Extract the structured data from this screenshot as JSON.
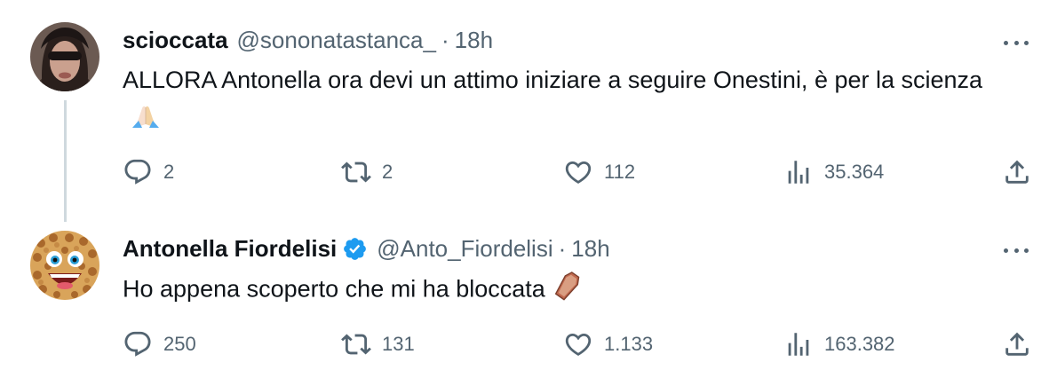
{
  "tweets": [
    {
      "name": "scioccata",
      "handle": "@sononatastanca_",
      "separator": "·",
      "time": "18h",
      "verified": false,
      "text": "ALLORA Antonella ora devi un attimo iniziare a seguire Onestini, è per la scienza",
      "emoji": "folded-hands",
      "replies": "2",
      "retweets": "2",
      "likes": "112",
      "views": "35.364"
    },
    {
      "name": "Antonella Fiordelisi",
      "handle": "@Anto_Fiordelisi",
      "separator": "·",
      "time": "18h",
      "verified": true,
      "text": "Ho appena scoperto che mi ha bloccata",
      "emoji": "coffin",
      "replies": "250",
      "retweets": "131",
      "likes": "1.133",
      "views": "163.382"
    }
  ],
  "colors": {
    "primary_text": "#0f1419",
    "secondary_text": "#536471",
    "thread_line": "#cfd9de",
    "verified_blue": "#1d9bf0"
  }
}
